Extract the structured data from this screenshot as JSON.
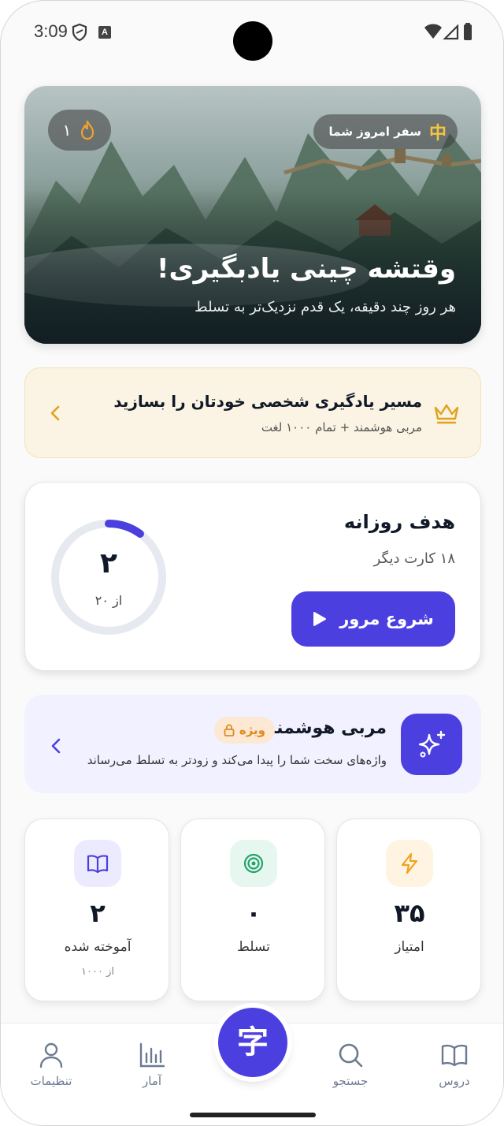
{
  "status_bar": {
    "time": "3:09",
    "keyboard_indicator": "A",
    "icons": [
      "shield-icon",
      "wifi-icon",
      "signal-icon",
      "battery-icon"
    ]
  },
  "hero": {
    "streak_count": "۱",
    "streak_icon": "flame-icon",
    "journey_label": "سفر امروز شما",
    "journey_glyph": "中",
    "title": "وقتشه چینی یادبگیری!",
    "subtitle": "هر روز چند دقیقه، یک قدم نزدیک‌تر به تسلط"
  },
  "premium_banner": {
    "title": "مسیر یادگیری شخصی خودتان را بسازید",
    "subtitle": "مربی هوشمند + تمام ۱۰۰۰ لغت",
    "icon": "crown-icon"
  },
  "daily_goal": {
    "title": "هدف روزانه",
    "remaining": "۱۸ کارت دیگر",
    "start_label": "شروع مرور",
    "count": "۲",
    "of_label": "از ۲۰",
    "progress_fraction": 0.1
  },
  "ai_coach": {
    "title": "مربی هوشمند",
    "badge": "ویژه",
    "description": "واژه‌های سخت شما را پیدا می‌کند و زودتر به تسلط می‌رساند",
    "icon": "sparkle-icon"
  },
  "stats": [
    {
      "icon": "lightning-icon",
      "value": "۳۵",
      "label": "امتیاز",
      "sub": "",
      "icon_bg": "#fff4e2",
      "icon_color": "#f0a31c"
    },
    {
      "icon": "target-icon",
      "value": "۰",
      "label": "تسلط",
      "sub": "",
      "icon_bg": "#e5f7ef",
      "icon_color": "#22a36b"
    },
    {
      "icon": "book-icon",
      "value": "۲",
      "label": "آموخته شده",
      "sub": "از ۱۰۰۰",
      "icon_bg": "#eceafe",
      "icon_color": "#4c3fe0"
    }
  ],
  "nav": {
    "center_glyph": "字",
    "items": [
      {
        "label": "دروس",
        "icon": "book-icon"
      },
      {
        "label": "جستجو",
        "icon": "search-icon"
      },
      {
        "label": "آمار",
        "icon": "bar-chart-icon"
      },
      {
        "label": "تنظیمات",
        "icon": "user-icon"
      }
    ]
  },
  "colors": {
    "accent": "#4c3fe0",
    "gold": "#e0a21c",
    "ring_track": "#e6e9f0"
  }
}
